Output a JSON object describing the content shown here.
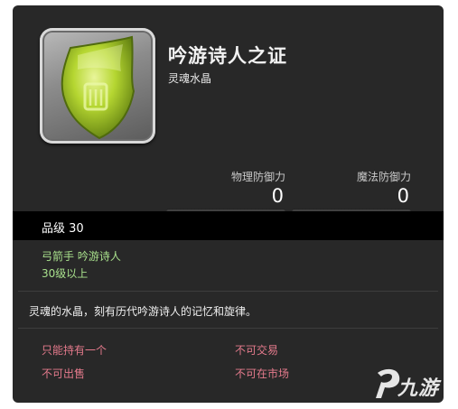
{
  "item": {
    "name": "吟游诗人之证",
    "category": "灵魂水晶"
  },
  "stats": {
    "physical_defense_label": "物理防御力",
    "physical_defense_value": "0",
    "magic_defense_label": "魔法防御力",
    "magic_defense_value": "0"
  },
  "item_level": "品级 30",
  "requirements": {
    "classes": "弓箭手 吟游诗人",
    "level": "30级以上"
  },
  "description": "灵魂的水晶，刻有历代吟游诗人的记忆和旋律。",
  "properties": {
    "unique": "只能持有一个",
    "untradable": "不可交易",
    "unsellable": "不可出售",
    "no_market": "不可在市场"
  },
  "watermark": "九游",
  "colors": {
    "card_background": "#282828",
    "requirement_text": "#a8e08c",
    "property_text": "#e47a8c",
    "crystal": "#b5d631"
  },
  "icons": {
    "item": "yellow-green-soul-crystal-icon",
    "watermark_logo": "jiuyou-logo-icon"
  }
}
